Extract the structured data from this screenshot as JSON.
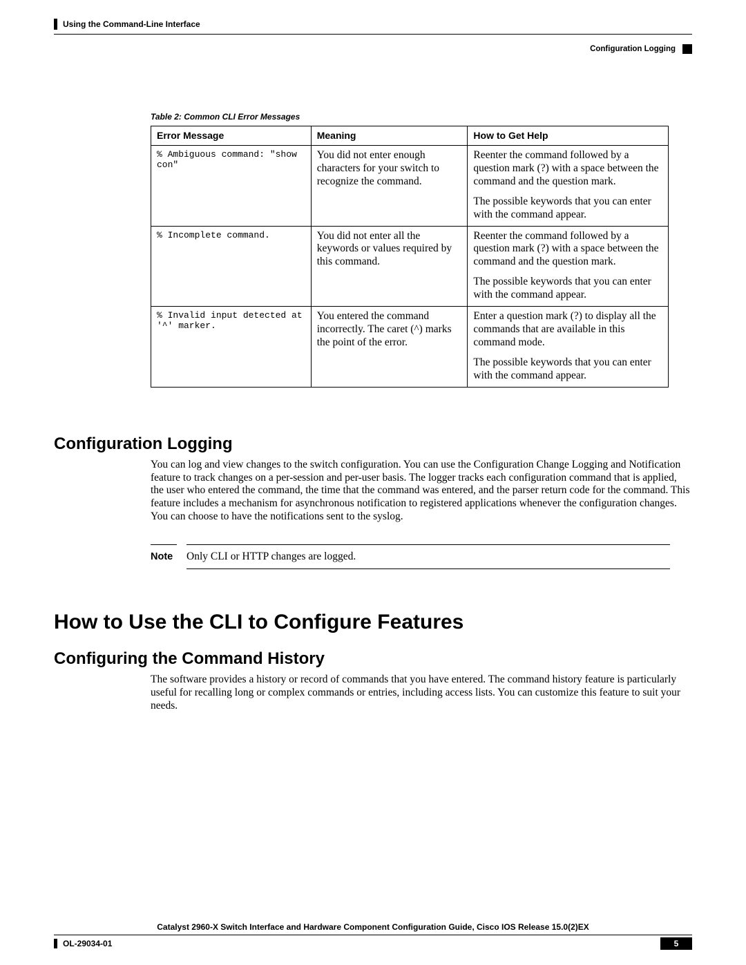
{
  "header": {
    "left": "Using the Command-Line Interface",
    "right": "Configuration Logging"
  },
  "table_caption": "Table 2: Common CLI Error Messages",
  "table": {
    "headers": [
      "Error Message",
      "Meaning",
      "How to Get Help"
    ],
    "rows": [
      {
        "error": "% Ambiguous command: \"show con\"",
        "meaning": "You did not enter enough characters for your switch to recognize the command.",
        "help_p1": "Reenter the command followed by a question mark (?) with a space between the command and the question mark.",
        "help_p2": "The possible keywords that you can enter with the command appear."
      },
      {
        "error": "% Incomplete command.",
        "meaning": "You did not enter all the keywords or values required by this command.",
        "help_p1": "Reenter the command followed by a question mark (?) with a space between the command and the question mark.",
        "help_p2": "The possible keywords that you can enter with the command appear."
      },
      {
        "error": "% Invalid input detected at '^' marker.",
        "meaning": "You entered the command incorrectly. The caret (^) marks the point of the error.",
        "help_p1": "Enter a question mark (?) to display all the commands that are available in this command mode.",
        "help_p2": "The possible keywords that you can enter with the command appear."
      }
    ]
  },
  "section1": {
    "title": "Configuration Logging",
    "body": "You can log and view changes to the switch configuration. You can use the Configuration Change Logging and Notification feature to track changes on a per-session and per-user basis. The logger tracks each configuration command that is applied, the user who entered the command, the time that the command was entered, and the parser return code for the command. This feature includes a mechanism for asynchronous notification to registered applications whenever the configuration changes. You can choose to have the notifications sent to the syslog."
  },
  "note": {
    "label": "Note",
    "text": "Only CLI or HTTP changes are logged."
  },
  "chapter": {
    "title": "How to Use the CLI to Configure Features"
  },
  "section2": {
    "title": "Configuring the Command History",
    "body": "The software provides a history or record of commands that you have entered. The command history feature is particularly useful for recalling long or complex commands or entries, including access lists. You can customize this feature to suit your needs."
  },
  "footer": {
    "title": "Catalyst 2960-X Switch Interface and Hardware Component Configuration Guide, Cisco IOS Release 15.0(2)EX",
    "left": "OL-29034-01",
    "page": "5"
  }
}
